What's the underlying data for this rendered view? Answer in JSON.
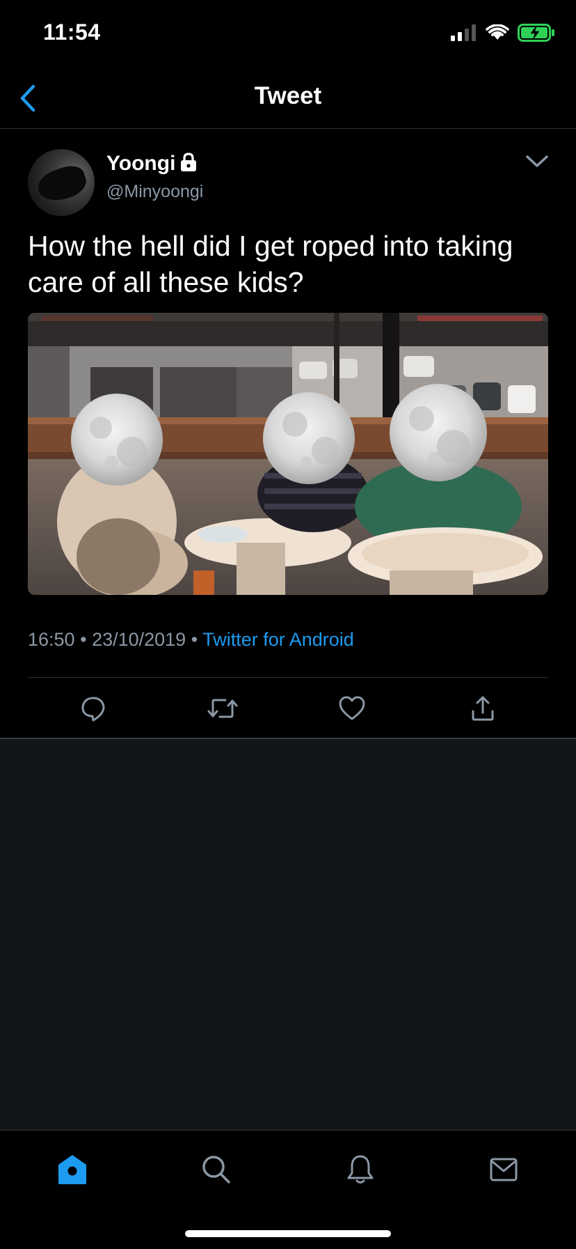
{
  "status_bar": {
    "time": "11:54"
  },
  "nav": {
    "title": "Tweet"
  },
  "tweet": {
    "author": {
      "display_name": "Yoongi",
      "handle": "@Minyoongi",
      "protected": true
    },
    "text": "How the hell did I get roped into taking care of all these kids?",
    "meta": {
      "time": "16:50",
      "date": "23/10/2019",
      "separator": "•",
      "source": "Twitter for Android"
    },
    "actions": [
      "reply-icon",
      "retweet-icon",
      "like-icon",
      "share-icon"
    ]
  },
  "tab_bar": {
    "items": [
      "home-icon",
      "search-icon",
      "notifications-icon",
      "messages-icon"
    ],
    "active": "home-icon"
  },
  "colors": {
    "accent": "#1d9bf0",
    "secondary_text": "#8b98a5",
    "background": "#000000",
    "empty_area": "#131618",
    "battery": "#30d158"
  }
}
